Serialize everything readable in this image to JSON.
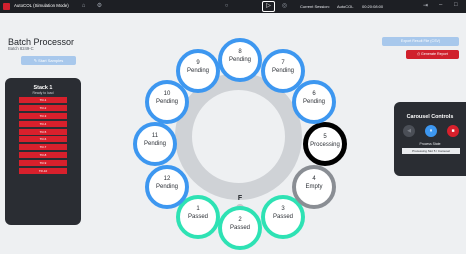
{
  "titlebar": {
    "app_title": "AutoCOL (Simulation Mode)",
    "play_glyph": "▷",
    "session_label": "Current Session:",
    "session_user": "AutoCOL",
    "session_time": "00:20:08:00",
    "icons": [
      "app-logo-icon",
      "home-icon",
      "settings-icon",
      "circle-icon",
      "play-icon",
      "gauge-icon",
      "logout-icon",
      "minimize-icon",
      "maximize-icon"
    ],
    "win_glyphs": {
      "logout": "⇥",
      "minimize": "–",
      "maximize": "□"
    }
  },
  "header": {
    "title": "Batch Processor",
    "subtitle": "Batch 8249-C",
    "start_button": "Start Samples"
  },
  "stack": {
    "title": "Stack 1",
    "subtitle": "Ready to load",
    "items": [
      "TR-1",
      "TR-2",
      "TR-3",
      "TR-4",
      "TR-5",
      "TR-6",
      "TR-7",
      "TR-8",
      "TR-9",
      "TR-10"
    ]
  },
  "carousel": {
    "center_label": "F",
    "slots": [
      {
        "number": "1",
        "status": "Passed",
        "state": "passed"
      },
      {
        "number": "2",
        "status": "Passed",
        "state": "passed"
      },
      {
        "number": "3",
        "status": "Passed",
        "state": "passed"
      },
      {
        "number": "4",
        "status": "Empty",
        "state": "empty"
      },
      {
        "number": "5",
        "status": "Processing",
        "state": "processing"
      },
      {
        "number": "6",
        "status": "Pending",
        "state": "pending"
      },
      {
        "number": "7",
        "status": "Pending",
        "state": "pending"
      },
      {
        "number": "8",
        "status": "Pending",
        "state": "pending"
      },
      {
        "number": "9",
        "status": "Pending",
        "state": "pending"
      },
      {
        "number": "10",
        "status": "Pending",
        "state": "pending"
      },
      {
        "number": "11",
        "status": "Pending",
        "state": "pending"
      },
      {
        "number": "12",
        "status": "Pending",
        "state": "pending"
      }
    ],
    "colors": {
      "pending": "#3d97f0",
      "passed": "#2ee2b4",
      "empty": "#8a8e94",
      "processing": "#000000"
    }
  },
  "actions": {
    "secondary_button": "Export Result File (CSV)",
    "generate_report": "Generate Report"
  },
  "controls": {
    "title": "Carousel Controls",
    "status_label": "Process State",
    "status_value": "Processing Slot 5 / Carousel",
    "buttons": [
      {
        "glyph": "◀",
        "icon": "previous-icon",
        "state": "disabled"
      },
      {
        "glyph": "⏸",
        "icon": "pause-icon",
        "state": "active"
      },
      {
        "glyph": "■",
        "icon": "stop-icon",
        "state": "danger"
      }
    ]
  },
  "palette": {
    "accent": "#3d97f0",
    "danger": "#d0202c",
    "dark_panel": "#2a2d33",
    "light_button": "#a8c8ec"
  }
}
